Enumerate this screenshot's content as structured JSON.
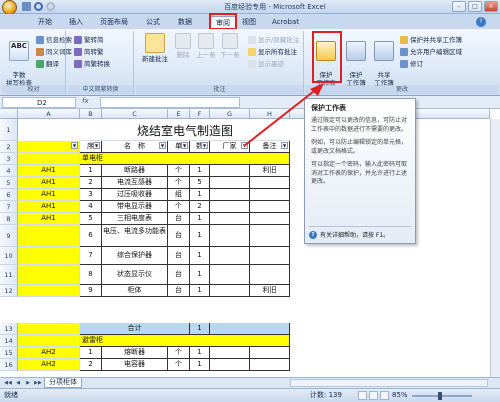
{
  "window": {
    "title": "百度经验专用 - Microsoft Excel"
  },
  "tabs": [
    {
      "label": "开始"
    },
    {
      "label": "插入"
    },
    {
      "label": "页面布局"
    },
    {
      "label": "公式"
    },
    {
      "label": "数据"
    },
    {
      "label": "审阅"
    },
    {
      "label": "视图"
    },
    {
      "label": "Acrobat"
    }
  ],
  "active_tab": "审阅",
  "ribbon": {
    "proofing": {
      "label": "校对",
      "spell": "字数\n拼写检查",
      "research": "信息检索",
      "thesaurus": "同义词库",
      "translate": "翻译"
    },
    "chinese": {
      "label": "中文简繁转换",
      "to_trad": "繁转简",
      "to_simp": "简转繁",
      "convert": "简繁转换"
    },
    "comments": {
      "label": "批注",
      "new": "新建批注",
      "delete": "删除",
      "prev": "上一条",
      "next": "下一条",
      "show_hide": "显示/隐藏批注",
      "show_all": "显示所有批注",
      "show_ink": "显示墨迹"
    },
    "changes": {
      "label": "更改",
      "protect_sheet": "保护\n工作表",
      "protect_wb": "保护\n工作簿",
      "share_wb": "共享\n工作簿",
      "protect_share": "保护并共享工作簿",
      "allow_edit": "允许用户编辑区域",
      "track": "修订"
    }
  },
  "formula_bar": {
    "name_box": "D2",
    "fx": "fx"
  },
  "tooltip": {
    "title": "保护工作表",
    "p1": "通过限定可以更改的信息，可防止对工作表中的数据进行不需要的更改。",
    "p2": "例如，可以防止编辑锁定的单元格，或更改文档格式。",
    "p3": "可以指定一个密码，输入此密码可取消对工作表的保护，并允许进行上述更改。",
    "help": "有关详细帮助，请按 F1。"
  },
  "sheet": {
    "columns": [
      "A",
      "B",
      "C",
      "D",
      "E",
      "F",
      "G",
      "H"
    ],
    "title": "烧结室电气制造图",
    "headers": [
      "序",
      "名　称",
      "单",
      "数",
      "厂家",
      "备注"
    ],
    "section1": "单电柜",
    "section2": "避雷柜",
    "row_nums": [
      "1",
      "2",
      "3",
      "4",
      "5",
      "6",
      "7",
      "8",
      "9",
      "10",
      "11",
      "12",
      "13",
      "14",
      "15",
      "16"
    ],
    "rows": [
      {
        "a": "AH1",
        "seq": "1",
        "name": "断路器",
        "unit": "个",
        "qty": "1",
        "note": "利旧"
      },
      {
        "a": "AH1",
        "seq": "2",
        "name": "电流互感器",
        "unit": "个",
        "qty": "5",
        "note": ""
      },
      {
        "a": "AH1",
        "seq": "3",
        "name": "过压吸收器",
        "unit": "组",
        "qty": "1",
        "note": ""
      },
      {
        "a": "AH1",
        "seq": "4",
        "name": "带电显示器",
        "unit": "个",
        "qty": "2",
        "note": ""
      },
      {
        "a": "AH1",
        "seq": "5",
        "name": "三相电度表",
        "unit": "台",
        "qty": "1",
        "note": ""
      },
      {
        "a": "",
        "seq": "6",
        "name": "电压、电流多功能表",
        "unit": "台",
        "qty": "1",
        "note": ""
      },
      {
        "a": "",
        "seq": "7",
        "name": "综合保护器",
        "unit": "台",
        "qty": "1",
        "note": ""
      },
      {
        "a": "",
        "seq": "8",
        "name": "状态显示仪",
        "unit": "台",
        "qty": "1",
        "note": ""
      },
      {
        "a": "",
        "seq": "9",
        "name": "柜体",
        "unit": "台",
        "qty": "1",
        "note": "利旧"
      }
    ],
    "subtotal": "合计",
    "subtotal_qty": "1",
    "rows2": [
      {
        "a": "AH2",
        "seq": "1",
        "name": "熔断器",
        "unit": "个",
        "qty": "1"
      },
      {
        "a": "AH2",
        "seq": "2",
        "name": "电容器",
        "unit": "个",
        "qty": "1"
      }
    ]
  },
  "sheet_tab": "分项柜体",
  "status": {
    "ready": "就绪",
    "count": "计数: 139",
    "zoom": "85%"
  }
}
